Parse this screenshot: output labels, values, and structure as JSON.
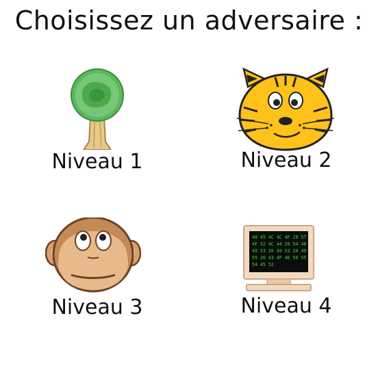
{
  "title": "Choisissez un adversaire :",
  "options": [
    {
      "label": "Niveau 1",
      "icon": "tree-icon"
    },
    {
      "label": "Niveau 2",
      "icon": "tiger-icon"
    },
    {
      "label": "Niveau 3",
      "icon": "monkey-icon"
    },
    {
      "label": "Niveau 4",
      "icon": "computer-icon"
    }
  ],
  "computer_screen_lines": [
    "48 45 4C 4C 4F 20 57",
    "4F 52 4C 44 20 54 48",
    "49 53 20 49 53 20 49",
    "59 20 43 4F 4E 50 55",
    "54 45 52"
  ],
  "colors": {
    "tree_foliage": "#5cb85c",
    "tiger_fur": "#ffc21a",
    "monkey_fur": "#d9a06b",
    "screen_text": "#33dd33"
  }
}
